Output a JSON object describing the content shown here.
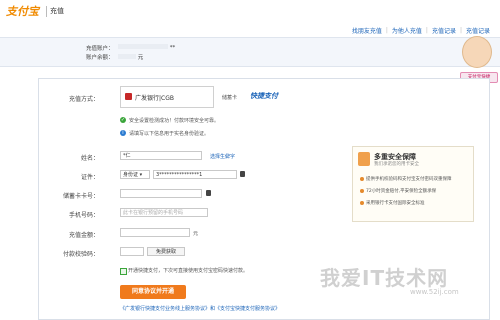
{
  "header": {
    "logo_text": "支付宝",
    "page_title": "充值",
    "links": [
      "找朋友充值",
      "为他人充值",
      "充值记录",
      "充值记录"
    ]
  },
  "account": {
    "recharge_account_label": "充值账户：",
    "recharge_account_value": "**",
    "balance_label": "账户余额：",
    "balance_value": "元"
  },
  "side": {
    "mascot_bubble": "支付宝快捷"
  },
  "form": {
    "method_label": "充值方式：",
    "bank_name": "广发银行|CGB",
    "card_type": "储蓄卡",
    "quickpay_logo": "快捷支付",
    "notice_secure": "安全设置检测成功！付款环境安全可靠。",
    "notice_realname": "请填写以下信息用于实名身份验证。",
    "name_label": "姓名：",
    "name_value": "*仁",
    "rare_char_link": "选择生僻字",
    "id_label": "证件：",
    "id_type": "身份证",
    "id_value": "3****************1",
    "card_label": "储蓄卡卡号：",
    "phone_label": "手机号码：",
    "phone_placeholder": "此卡在银行预留的手机号码",
    "amount_label": "充值金额：",
    "amount_unit": "元",
    "sms_label": "付款校验码：",
    "sms_button": "免费获取",
    "agree_text": "开通快捷支付，下次可直接使用支付宝密码快速付款。",
    "submit_button": "同意协议并开通",
    "footer_text": "《广发银行快捷支付业务线上服务协议》和《支付宝快捷支付服务协议》"
  },
  "security_panel": {
    "title": "多重安全保障",
    "subtitle": "我们承诺您的用卡安全",
    "items": [
      "提供手机校验码和支付宝支付密码双重保障",
      "72小时资金赔付,平安保险全额承保",
      "采用银行卡支付国际安全标准"
    ]
  },
  "watermark": {
    "main": "我爱IT技术网",
    "sub": "www.52ij.com"
  },
  "colors": {
    "brand_orange": "#f07a1c",
    "link_blue": "#1a63b8",
    "success_green": "#3aa53a"
  }
}
